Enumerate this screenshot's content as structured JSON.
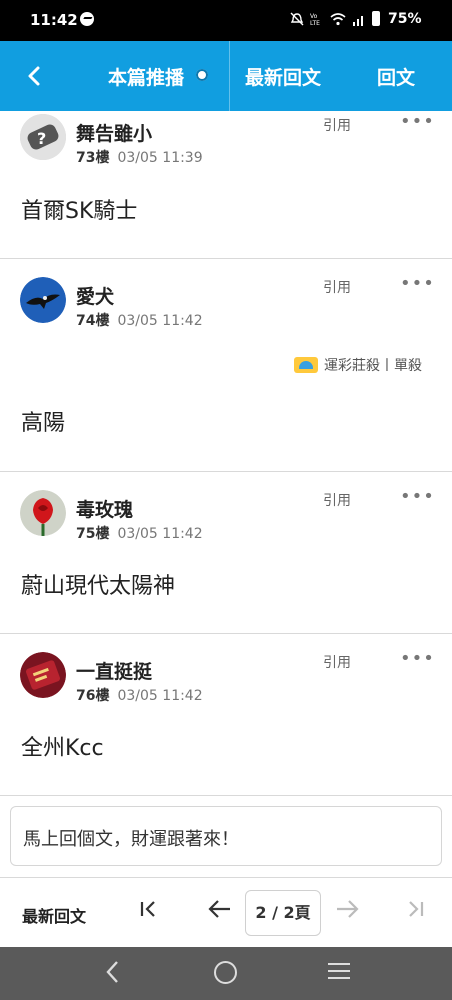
{
  "status_bar": {
    "time": "11:42",
    "battery": "75%",
    "app_icon": "messenger-icon",
    "indicator_icons": [
      "mute-icon",
      "volte-icon",
      "wifi-icon",
      "signal-icon",
      "battery-icon"
    ]
  },
  "app_bar": {
    "back_icon": "back-arrow-icon",
    "tabs": [
      {
        "label": "本篇推播"
      },
      {
        "label": "最新回文"
      },
      {
        "label": "回文"
      }
    ]
  },
  "posts": [
    {
      "author": "舞告雖小",
      "floor": "73樓",
      "time": "03/05 11:39",
      "quote_label": "引用",
      "more": "•••",
      "content": "首爾SK騎士",
      "avatar": "question-mark-avatar"
    },
    {
      "author": "愛犬",
      "floor": "74樓",
      "time": "03/05 11:42",
      "quote_label": "引用",
      "more": "•••",
      "content": "高陽",
      "signature": "運彩莊殺丨單殺",
      "avatar": "eagle-avatar"
    },
    {
      "author": "毒玫瑰",
      "floor": "75樓",
      "time": "03/05 11:42",
      "quote_label": "引用",
      "more": "•••",
      "content": "蔚山現代太陽神",
      "avatar": "rose-avatar"
    },
    {
      "author": "一直挺挺",
      "floor": "76樓",
      "time": "03/05 11:42",
      "quote_label": "引用",
      "more": "•••",
      "content": "全州Kcc",
      "avatar": "red-card-avatar"
    }
  ],
  "reply": {
    "placeholder": "馬上回個文，財運跟著來！"
  },
  "pager": {
    "latest_label": "最新回文",
    "page_indicator": "2 / 2頁",
    "first_icon": "first-page-icon",
    "prev_icon": "prev-page-icon",
    "next_icon": "next-page-icon",
    "last_icon": "last-page-icon"
  },
  "nav_bar": {
    "icons": [
      "back-icon",
      "home-icon",
      "recents-icon"
    ]
  }
}
